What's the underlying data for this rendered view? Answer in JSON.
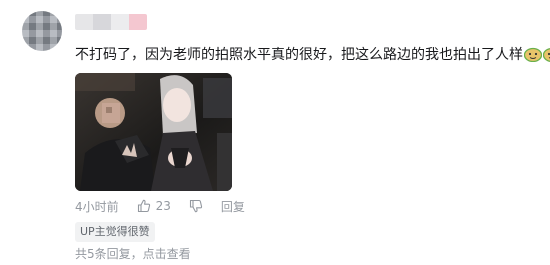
{
  "comment": {
    "username": "▇▇▇▇",
    "text": "不打码了，因为老师的拍照水平真的很好，把这么路边的我也拍出了人样",
    "emojis": [
      "doge-emoji",
      "doge-emoji"
    ],
    "photo_alt": "selfie-photo"
  },
  "meta": {
    "time": "4小时前",
    "like_count": "23",
    "reply_label": "回复"
  },
  "badge": {
    "label": "UP主觉得很赞"
  },
  "replies": {
    "summary_prefix": "共5条回复，",
    "summary_link": "点击查看"
  },
  "colors": {
    "text": "#18191c",
    "meta": "#9499a0",
    "badge_bg": "#f1f2f3"
  }
}
